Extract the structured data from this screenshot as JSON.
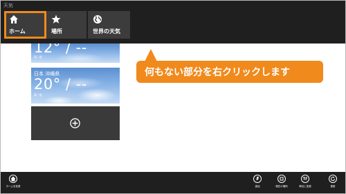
{
  "app": {
    "title": "天気"
  },
  "nav": {
    "tiles": [
      {
        "label": "ホーム",
        "icon": "home-icon",
        "selected": true
      },
      {
        "label": "場所",
        "icon": "star-icon",
        "selected": false
      },
      {
        "label": "世界の天気",
        "icon": "globe-icon",
        "selected": false
      }
    ]
  },
  "weather_tiles": [
    {
      "place": "",
      "temperature": "12° / --",
      "hilo": "高 / 低"
    },
    {
      "place": "日本 沖縄県",
      "temperature": "20° / --",
      "hilo": "高 / 低"
    }
  ],
  "add_tile": {
    "icon": "add-circle-icon"
  },
  "callout": {
    "text": "何もない部分を右クリックします",
    "color": "#f08a1c"
  },
  "bottom_bar": {
    "left": [
      {
        "label": "ホームを変更",
        "icon": "home-change-icon"
      }
    ],
    "right": [
      {
        "label": "追加",
        "icon": "pin-icon"
      },
      {
        "label": "現在の場所",
        "icon": "location-icon"
      },
      {
        "label": "単位に変更",
        "icon": "units-icon"
      },
      {
        "label": "更新",
        "icon": "refresh-icon"
      }
    ]
  }
}
